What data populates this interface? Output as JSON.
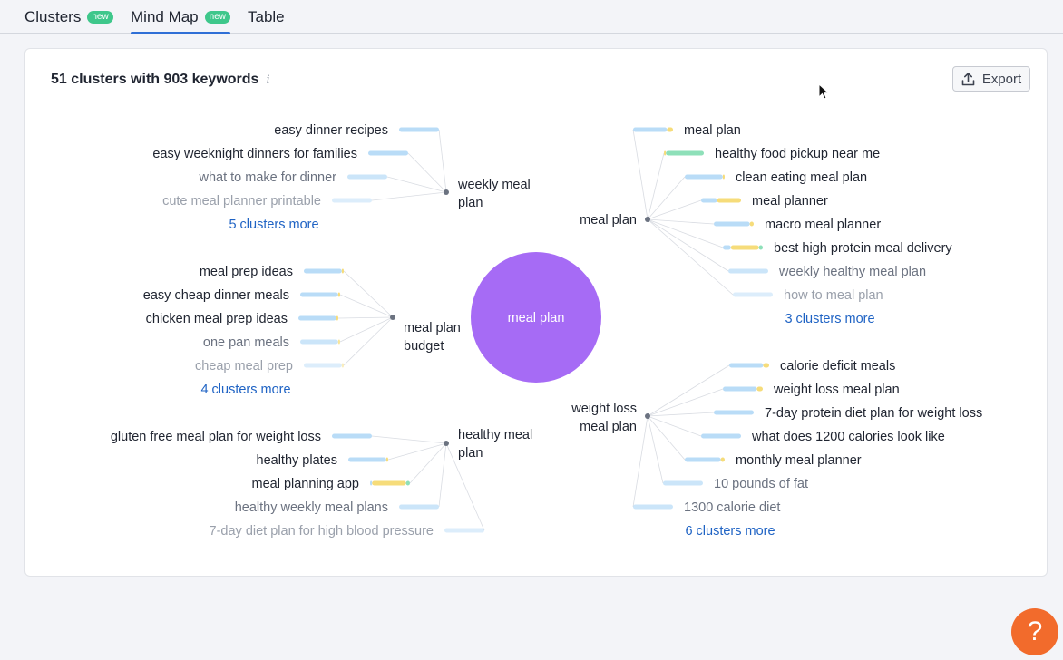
{
  "tabs": [
    {
      "label": "Clusters",
      "badge": "new"
    },
    {
      "label": "Mind Map",
      "badge": "new"
    },
    {
      "label": "Table",
      "badge": ""
    }
  ],
  "card": {
    "title": "51 clusters with 903 keywords",
    "info_icon": "i",
    "export_label": "Export"
  },
  "mindmap": {
    "center": {
      "label": "meal plan",
      "color": "#a66bf5"
    },
    "clusters": [
      {
        "label": [
          "weekly meal",
          "plan"
        ],
        "side": "left",
        "more": "5 clusters more",
        "keywords": [
          {
            "text": "easy dinner recipes",
            "level": 1.0,
            "bar": [
              1.0,
              0,
              0
            ]
          },
          {
            "text": "easy weeknight dinners for families",
            "level": 1.0,
            "bar": [
              1.0,
              0,
              0
            ]
          },
          {
            "text": "what to make for dinner",
            "level": 0.8,
            "bar": [
              1.0,
              0,
              0
            ]
          },
          {
            "text": "cute meal planner printable",
            "level": 0.6,
            "bar": [
              1.0,
              0,
              0
            ]
          }
        ]
      },
      {
        "label": [
          "meal plan",
          "budget"
        ],
        "side": "left",
        "more": "4 clusters more",
        "keywords": [
          {
            "text": "meal prep ideas",
            "level": 1.0,
            "bar": [
              0.95,
              0.05,
              0
            ]
          },
          {
            "text": "easy cheap dinner meals",
            "level": 1.0,
            "bar": [
              0.95,
              0.05,
              0
            ]
          },
          {
            "text": "chicken meal prep ideas",
            "level": 1.0,
            "bar": [
              0.95,
              0.05,
              0
            ]
          },
          {
            "text": "one pan meals",
            "level": 0.8,
            "bar": [
              0.95,
              0.05,
              0
            ]
          },
          {
            "text": "cheap meal prep",
            "level": 0.6,
            "bar": [
              0.95,
              0.05,
              0
            ]
          }
        ]
      },
      {
        "label": [
          "healthy meal",
          "plan"
        ],
        "side": "left",
        "more": "",
        "keywords": [
          {
            "text": "gluten free meal plan for weight loss",
            "level": 1.0,
            "bar": [
              1.0,
              0,
              0
            ]
          },
          {
            "text": "healthy plates",
            "level": 1.0,
            "bar": [
              0.95,
              0.05,
              0
            ]
          },
          {
            "text": "meal planning app",
            "level": 1.0,
            "bar": [
              0.05,
              0.85,
              0.1
            ]
          },
          {
            "text": "healthy weekly meal plans",
            "level": 0.8,
            "bar": [
              1.0,
              0,
              0
            ]
          },
          {
            "text": "7-day diet plan for high blood pressure",
            "level": 0.6,
            "bar": [
              1.0,
              0,
              0
            ]
          }
        ]
      },
      {
        "label": [
          "meal plan"
        ],
        "side": "right",
        "more": "3 clusters more",
        "keywords": [
          {
            "text": "meal plan",
            "level": 1.0,
            "bar": [
              0.85,
              0.15,
              0
            ]
          },
          {
            "text": "healthy food pickup near me",
            "level": 1.0,
            "bar": [
              0,
              0.05,
              0.95
            ]
          },
          {
            "text": "clean eating meal plan",
            "level": 1.0,
            "bar": [
              0.95,
              0.05,
              0
            ]
          },
          {
            "text": "meal planner",
            "level": 1.0,
            "bar": [
              0.4,
              0.6,
              0
            ]
          },
          {
            "text": "macro meal planner",
            "level": 1.0,
            "bar": [
              0.9,
              0.1,
              0
            ]
          },
          {
            "text": "best high protein meal delivery",
            "level": 1.0,
            "bar": [
              0.2,
              0.7,
              0.1
            ]
          },
          {
            "text": "weekly healthy meal plan",
            "level": 0.8,
            "bar": [
              1.0,
              0,
              0
            ]
          },
          {
            "text": "how to meal plan",
            "level": 0.6,
            "bar": [
              1.0,
              0,
              0
            ]
          }
        ]
      },
      {
        "label": [
          "weight loss",
          "meal plan"
        ],
        "side": "right",
        "more": "6 clusters more",
        "keywords": [
          {
            "text": "calorie deficit meals",
            "level": 1.0,
            "bar": [
              0.85,
              0.15,
              0
            ]
          },
          {
            "text": "weight loss meal plan",
            "level": 1.0,
            "bar": [
              0.85,
              0.15,
              0
            ]
          },
          {
            "text": "7-day protein diet plan for weight loss",
            "level": 1.0,
            "bar": [
              1.0,
              0,
              0
            ]
          },
          {
            "text": "what does 1200 calories look like",
            "level": 1.0,
            "bar": [
              1.0,
              0,
              0
            ]
          },
          {
            "text": "monthly meal planner",
            "level": 1.0,
            "bar": [
              0.9,
              0.1,
              0
            ]
          },
          {
            "text": "10 pounds of fat",
            "level": 0.8,
            "bar": [
              1.0,
              0,
              0
            ]
          },
          {
            "text": "1300 calorie diet",
            "level": 0.8,
            "bar": [
              1.0,
              0,
              0
            ]
          }
        ]
      }
    ]
  },
  "colors": {
    "bar_blue": "#b9dcf7",
    "bar_yellow": "#f6dc7a",
    "bar_green": "#8ee0b9",
    "link_blue": "#1f63c4",
    "accent": "#2f6fd6",
    "help": "#f26b2c"
  },
  "help": {
    "label": "?"
  }
}
